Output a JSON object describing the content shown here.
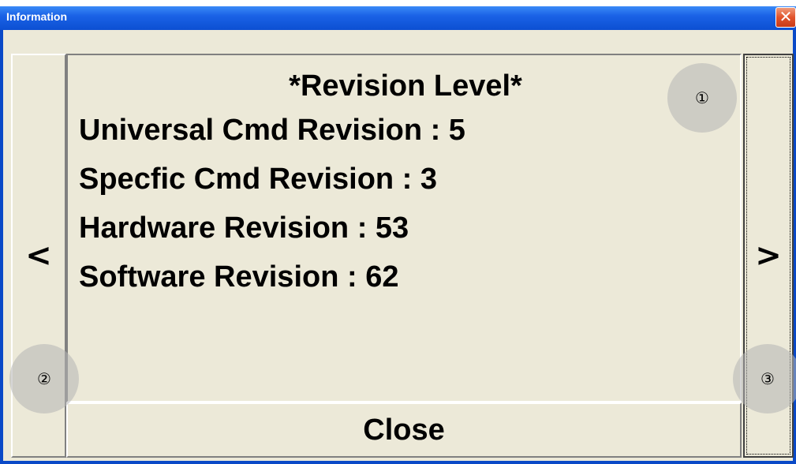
{
  "window": {
    "title": "Information",
    "close_glyph": "✕"
  },
  "info": {
    "heading": "*Revision Level*",
    "lines": [
      "Universal Cmd Revision : 5",
      "Specfic Cmd Revision : 3",
      "Hardware Revision : 53",
      "Software Revision : 62"
    ]
  },
  "nav": {
    "prev_label": "<",
    "next_label": ">"
  },
  "close_button": {
    "label": "Close"
  },
  "markers": [
    "①",
    "②",
    "③"
  ],
  "colors": {
    "titlebar": "#0a58e0",
    "window_bg": "#ece9d8",
    "close_x": "#e1532c"
  }
}
